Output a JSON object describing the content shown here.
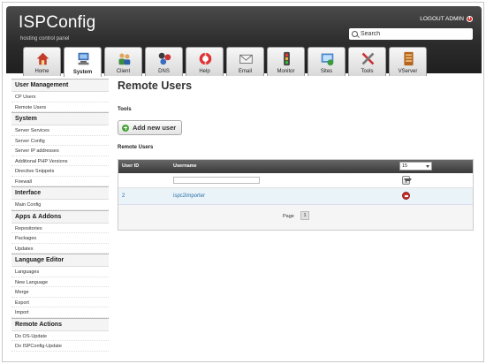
{
  "header": {
    "logo": "ISPConfig",
    "tagline": "hosting control panel",
    "logout": "LOGOUT ADMIN",
    "search_placeholder": "Search"
  },
  "tabs": [
    {
      "label": "Home",
      "icon": "home-icon",
      "active": false
    },
    {
      "label": "System",
      "icon": "system-icon",
      "active": true
    },
    {
      "label": "Client",
      "icon": "client-icon",
      "active": false
    },
    {
      "label": "DNS",
      "icon": "dns-icon",
      "active": false
    },
    {
      "label": "Help",
      "icon": "help-icon",
      "active": false
    },
    {
      "label": "Email",
      "icon": "email-icon",
      "active": false
    },
    {
      "label": "Monitor",
      "icon": "monitor-icon",
      "active": false
    },
    {
      "label": "Sites",
      "icon": "sites-icon",
      "active": false
    },
    {
      "label": "Tools",
      "icon": "tools-icon",
      "active": false
    },
    {
      "label": "VServer",
      "icon": "vserver-icon",
      "active": false
    }
  ],
  "sidebar": [
    {
      "title": "User Management",
      "items": [
        "CP Users",
        "Remote Users"
      ]
    },
    {
      "title": "System",
      "items": [
        "Server Services",
        "Server Config",
        "Server IP addresses",
        "Additional PHP Versions",
        "Directive Snippets",
        "Firewall"
      ]
    },
    {
      "title": "Interface",
      "items": [
        "Main Config"
      ]
    },
    {
      "title": "Apps & Addons",
      "items": [
        "Repositories",
        "Packages",
        "Updates"
      ]
    },
    {
      "title": "Language Editor",
      "items": [
        "Languages",
        "New Language",
        "Merge",
        "Export",
        "Import"
      ]
    },
    {
      "title": "Remote Actions",
      "items": [
        "Do OS-Update",
        "Do ISPConfig-Update"
      ]
    }
  ],
  "main": {
    "title": "Remote Users",
    "tools_label": "Tools",
    "add_button": "Add new user",
    "list_label": "Remote Users",
    "columns": [
      "User ID",
      "Username"
    ],
    "limit": "15",
    "rows": [
      {
        "id": "2",
        "username": "ispc2importer"
      }
    ],
    "pager_label": "Page",
    "page": "1"
  },
  "colors": {
    "header_bg": "#2c2c2c",
    "row_bg": "#eaf3f8",
    "link": "#2a6fa8",
    "add_green": "#48a53a",
    "delete_red": "#c9302c"
  }
}
